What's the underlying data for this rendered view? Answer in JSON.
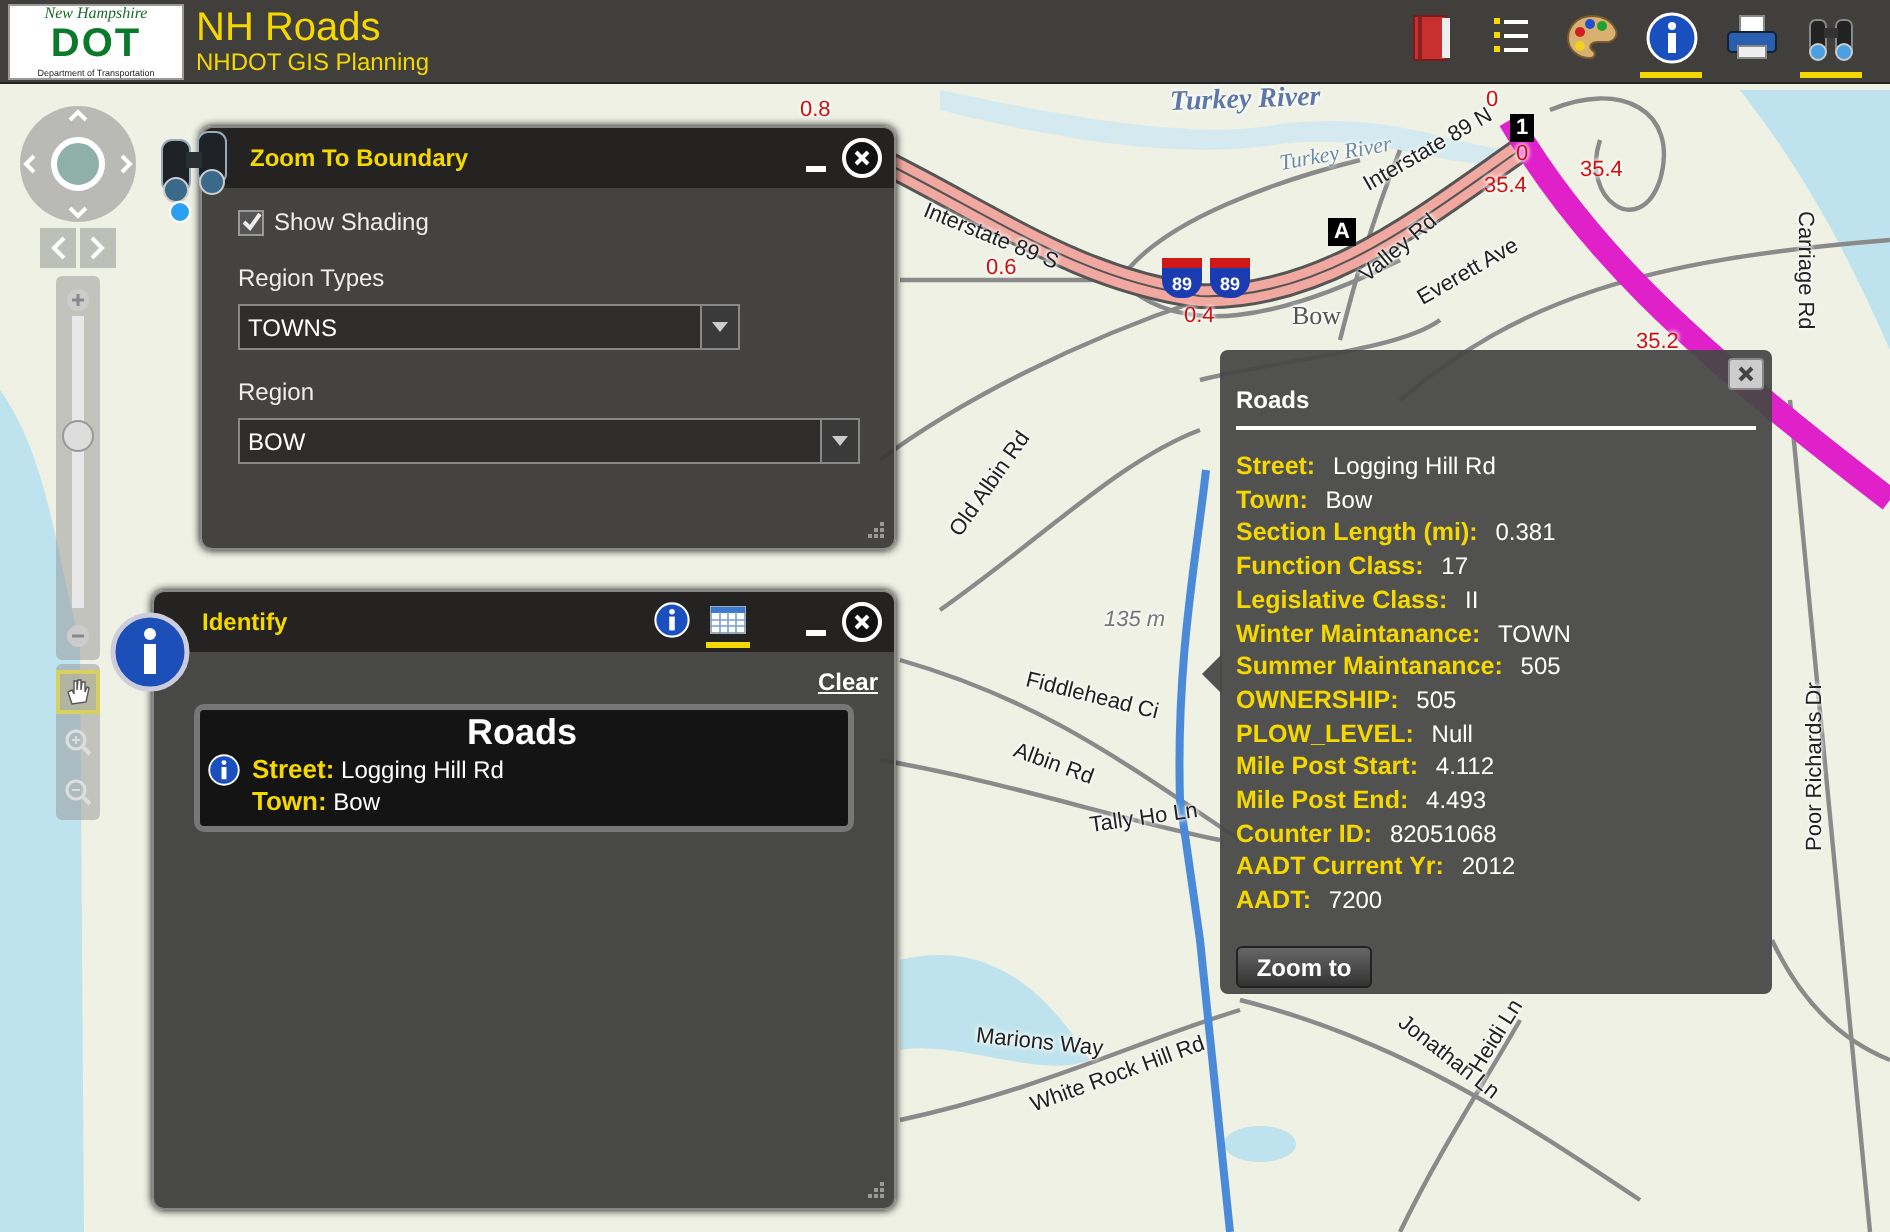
{
  "header": {
    "logo": {
      "top_text": "New Hampshire",
      "main": "DOT",
      "bottom_text": "Department of Transportation"
    },
    "title": "NH Roads",
    "subtitle": "NHDOT GIS Planning",
    "tools": [
      {
        "kind": "book",
        "selected": false
      },
      {
        "kind": "list",
        "selected": false
      },
      {
        "kind": "palette",
        "selected": false
      },
      {
        "kind": "info",
        "selected": true
      },
      {
        "kind": "printer",
        "selected": false
      },
      {
        "kind": "binoculars",
        "selected": true
      }
    ]
  },
  "navigation": {
    "zoom_slider": {
      "level": 0.6
    },
    "tools": [
      {
        "kind": "pan",
        "selected": true
      },
      {
        "kind": "zoom_in",
        "selected": false
      },
      {
        "kind": "zoom_out",
        "selected": false
      }
    ]
  },
  "zoom_to_boundary": {
    "title": "Zoom To Boundary",
    "show_shading": {
      "label": "Show Shading",
      "checked": true
    },
    "region_types": {
      "label": "Region Types",
      "value": "TOWNS"
    },
    "region": {
      "label": "Region",
      "value": "BOW"
    }
  },
  "identify": {
    "title": "Identify",
    "tabs": [
      {
        "kind": "info",
        "selected": false
      },
      {
        "kind": "table",
        "selected": true
      }
    ],
    "clear": "Clear",
    "result": {
      "layer": "Roads",
      "fields": [
        {
          "label": "Street:",
          "value": "Logging Hill Rd"
        },
        {
          "label": "Town:",
          "value": "Bow"
        }
      ]
    }
  },
  "popup": {
    "title": "Roads",
    "fields": [
      {
        "label": "Street:",
        "value": "Logging Hill Rd"
      },
      {
        "label": "Town:",
        "value": "Bow"
      },
      {
        "label": "Section Length (mi):",
        "value": "0.381"
      },
      {
        "label": "Function Class:",
        "value": "17"
      },
      {
        "label": "Legislative Class:",
        "value": "II"
      },
      {
        "label": "Winter Maintanance:",
        "value": "TOWN"
      },
      {
        "label": "Summer Maintanance:",
        "value": "505"
      },
      {
        "label": "OWNERSHIP:",
        "value": "505"
      },
      {
        "label": "PLOW_LEVEL:",
        "value": "Null"
      },
      {
        "label": "Mile Post Start:",
        "value": "4.112"
      },
      {
        "label": "Mile Post End:",
        "value": "4.493"
      },
      {
        "label": "Counter ID:",
        "value": "82051068"
      },
      {
        "label": "AADT Current Yr:",
        "value": "2012"
      },
      {
        "label": "AADT:",
        "value": "7200"
      }
    ],
    "button": "Zoom to"
  },
  "map": {
    "water_labels": [
      "Turkey River",
      "Turkey River"
    ],
    "road_labels": [
      "Interstate 89 S",
      "Interstate 89 N",
      "Valley Rd",
      "Everett Ave",
      "Carriage Rd",
      "Old Albin Rd",
      "Fiddlehead Ci",
      "Albin Rd",
      "Tally Ho Ln",
      "Marions Way",
      "White Rock Hill Rd",
      "Jonathan Ln",
      "Heidi Ln",
      "Poor Richards Dr"
    ],
    "place_labels": [
      "Bow"
    ],
    "elevation_labels": [
      "135 m"
    ],
    "milepost_labels": [
      "0.8",
      "0.6",
      "0.4",
      "0",
      "0",
      "35.4",
      "35.4",
      "35.2"
    ],
    "shield_labels": [
      "89",
      "89"
    ],
    "exit_markers": [
      "A",
      "1"
    ]
  }
}
